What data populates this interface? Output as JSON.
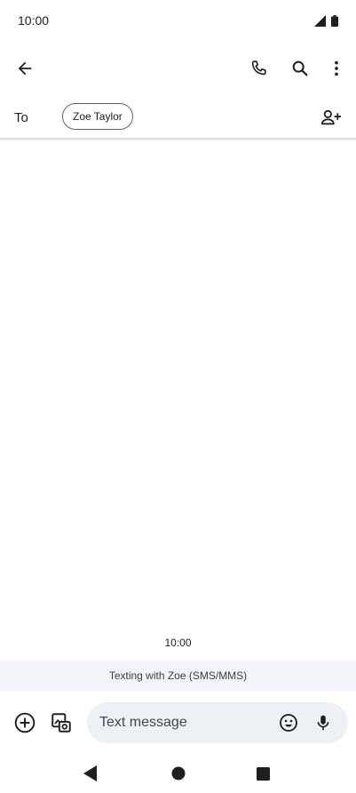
{
  "status_bar": {
    "time": "10:00"
  },
  "recipients": {
    "to_label": "To",
    "chips": [
      {
        "name": "Zoe Taylor"
      }
    ]
  },
  "conversation": {
    "timestamp": "10:00",
    "mode_banner": "Texting with Zoe (SMS/MMS)"
  },
  "compose": {
    "placeholder": "Text message"
  },
  "icons": {
    "back": "arrow-back-icon",
    "call": "phone-icon",
    "search": "search-icon",
    "more": "more-vert-icon",
    "add_person": "person-add-icon",
    "add": "add-circle-icon",
    "gallery": "gallery-icon",
    "emoji": "emoji-icon",
    "mic": "mic-icon"
  },
  "colors": {
    "chip_border": "#5f6368",
    "compose_bg": "#edf0f5",
    "banner_bg": "#f1f4f9",
    "icon": "#1f1f1f"
  }
}
